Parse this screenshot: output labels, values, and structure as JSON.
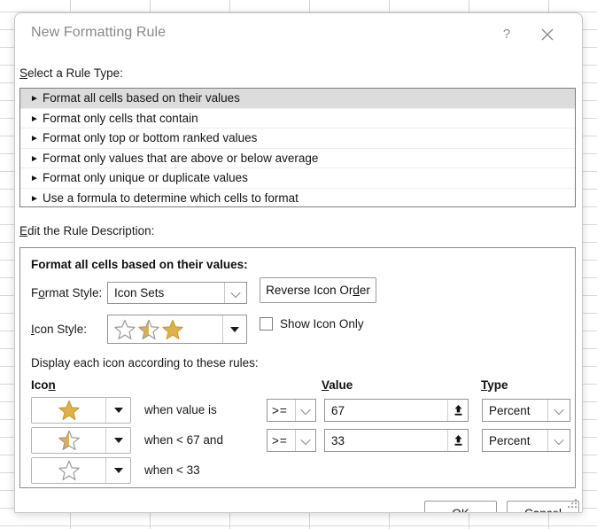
{
  "dialog": {
    "title": "New Formatting Rule",
    "help_icon": "question-mark-icon",
    "close_icon": "close-icon"
  },
  "rule_type": {
    "label_prefix": "S",
    "label_rest": "elect a Rule Type:",
    "items": [
      {
        "label": "Format all cells based on their values",
        "selected": true
      },
      {
        "label": "Format only cells that contain",
        "selected": false
      },
      {
        "label": "Format only top or bottom ranked values",
        "selected": false
      },
      {
        "label": "Format only values that are above or below average",
        "selected": false
      },
      {
        "label": "Format only unique or duplicate values",
        "selected": false
      },
      {
        "label": "Use a formula to determine which cells to format",
        "selected": false
      }
    ],
    "bullet": "►"
  },
  "rule_description": {
    "label_prefix": "E",
    "label_rest": "dit the Rule Description:",
    "heading": "Format all cells based on their values:",
    "format_style": {
      "label_a": "F",
      "label_b": "o",
      "label_c": "rmat Style:",
      "value": "Icon Sets"
    },
    "icon_style": {
      "label_a": "I",
      "label_b": "c",
      "label_c": "on Style:",
      "preview": [
        "star-empty",
        "star-half",
        "star-full"
      ]
    },
    "reverse_button": {
      "part1": "Reverse Icon Or",
      "accel": "d",
      "part2": "er"
    },
    "show_icon_only": {
      "part1": "Show ",
      "accel": "I",
      "part2": "con Only",
      "checked": false
    },
    "display_caption": "Display each icon according to these rules:",
    "columns": {
      "icon_a": "Ico",
      "icon_accel": "n",
      "value_accel": "V",
      "value_rest": "alue",
      "type_accel": "T",
      "type_rest": "ype"
    },
    "rows": [
      {
        "icon": "star-full",
        "when_text": "when value is",
        "operator": ">=",
        "value": "67",
        "type": "Percent",
        "has_value_controls": true
      },
      {
        "icon": "star-half",
        "when_text": "when < 67 and",
        "operator": ">=",
        "value": "33",
        "type": "Percent",
        "has_value_controls": true
      },
      {
        "icon": "star-empty",
        "when_text": "when < 33",
        "operator": "",
        "value": "",
        "type": "",
        "has_value_controls": false
      }
    ]
  },
  "footer": {
    "ok_label": "OK",
    "cancel_label": "Cancel"
  },
  "colors": {
    "star_gold": "#d8a838",
    "star_gold_fill": "#e0b04a",
    "star_outline": "#9a9a9a",
    "selection_bg": "#dcdcdc",
    "dialog_border": "#c8c6c4"
  }
}
